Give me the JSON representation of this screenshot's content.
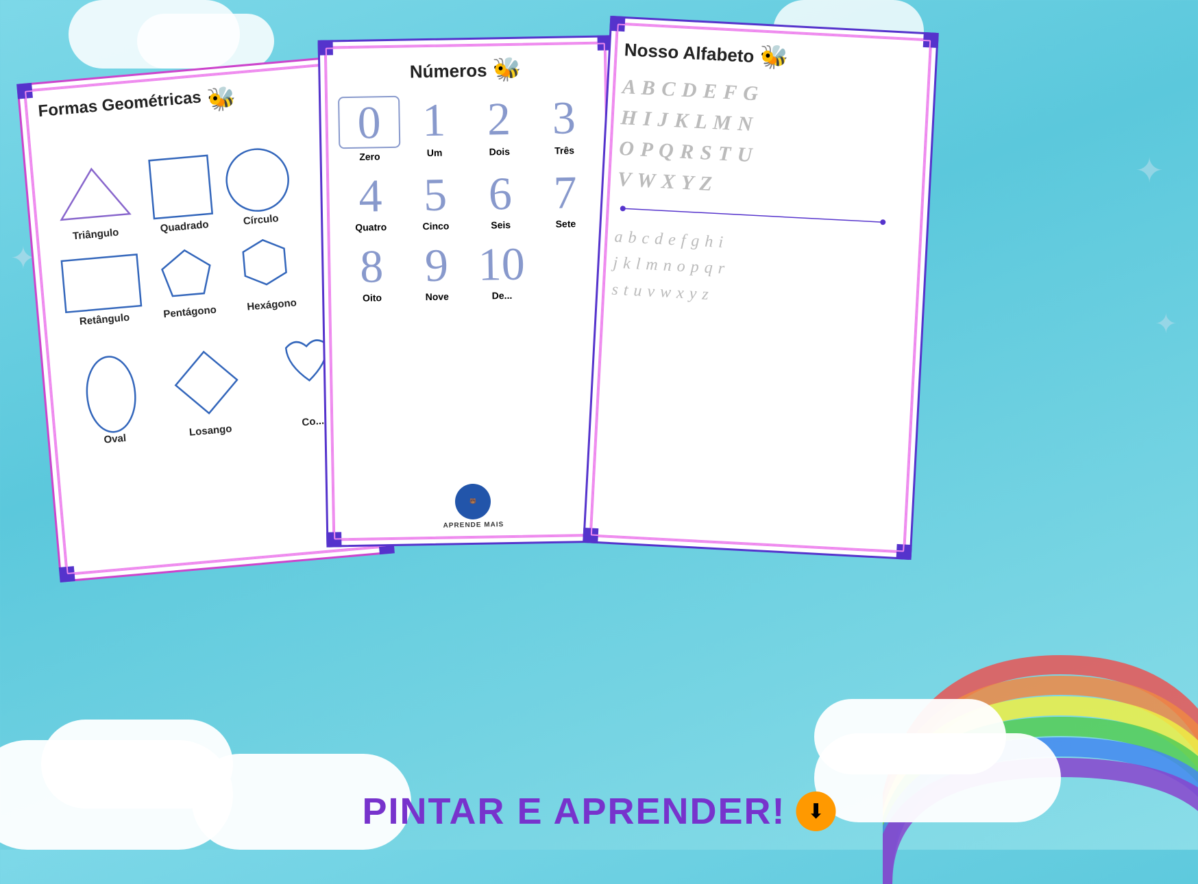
{
  "background": {
    "color": "#6ed0e0"
  },
  "cards": {
    "left": {
      "title": "Formas Geométricas",
      "shapes": [
        "Triângulo",
        "Quadrado",
        "Círculo",
        "Retângulo",
        "Pentágono",
        "Hexágono",
        "Oval",
        "Losango",
        "Coração"
      ]
    },
    "middle": {
      "title": "Números",
      "numbers": [
        {
          "digit": "0",
          "label": "Zero"
        },
        {
          "digit": "1",
          "label": "Um"
        },
        {
          "digit": "2",
          "label": "Dois"
        },
        {
          "digit": "3",
          "label": "Três"
        },
        {
          "digit": "4",
          "label": "Quatro"
        },
        {
          "digit": "5",
          "label": "Cinco"
        },
        {
          "digit": "6",
          "label": "Seis"
        },
        {
          "digit": "7",
          "label": "Sete"
        },
        {
          "digit": "8",
          "label": "Oito"
        },
        {
          "digit": "9",
          "label": "Nove"
        },
        {
          "digit": "10",
          "label": "Dez"
        }
      ]
    },
    "right": {
      "title": "Nosso Alfabeto",
      "uppercase": "A B C D E F G\nH I J K L M N\nO P Q R S T U\nV W X Y Z",
      "lowercase": "a b c d e f g h i\nj k l m n o p q r\ns t u v w x y z"
    }
  },
  "cta": {
    "text": "PINTAR E APRENDER!",
    "icon": "⬇"
  }
}
